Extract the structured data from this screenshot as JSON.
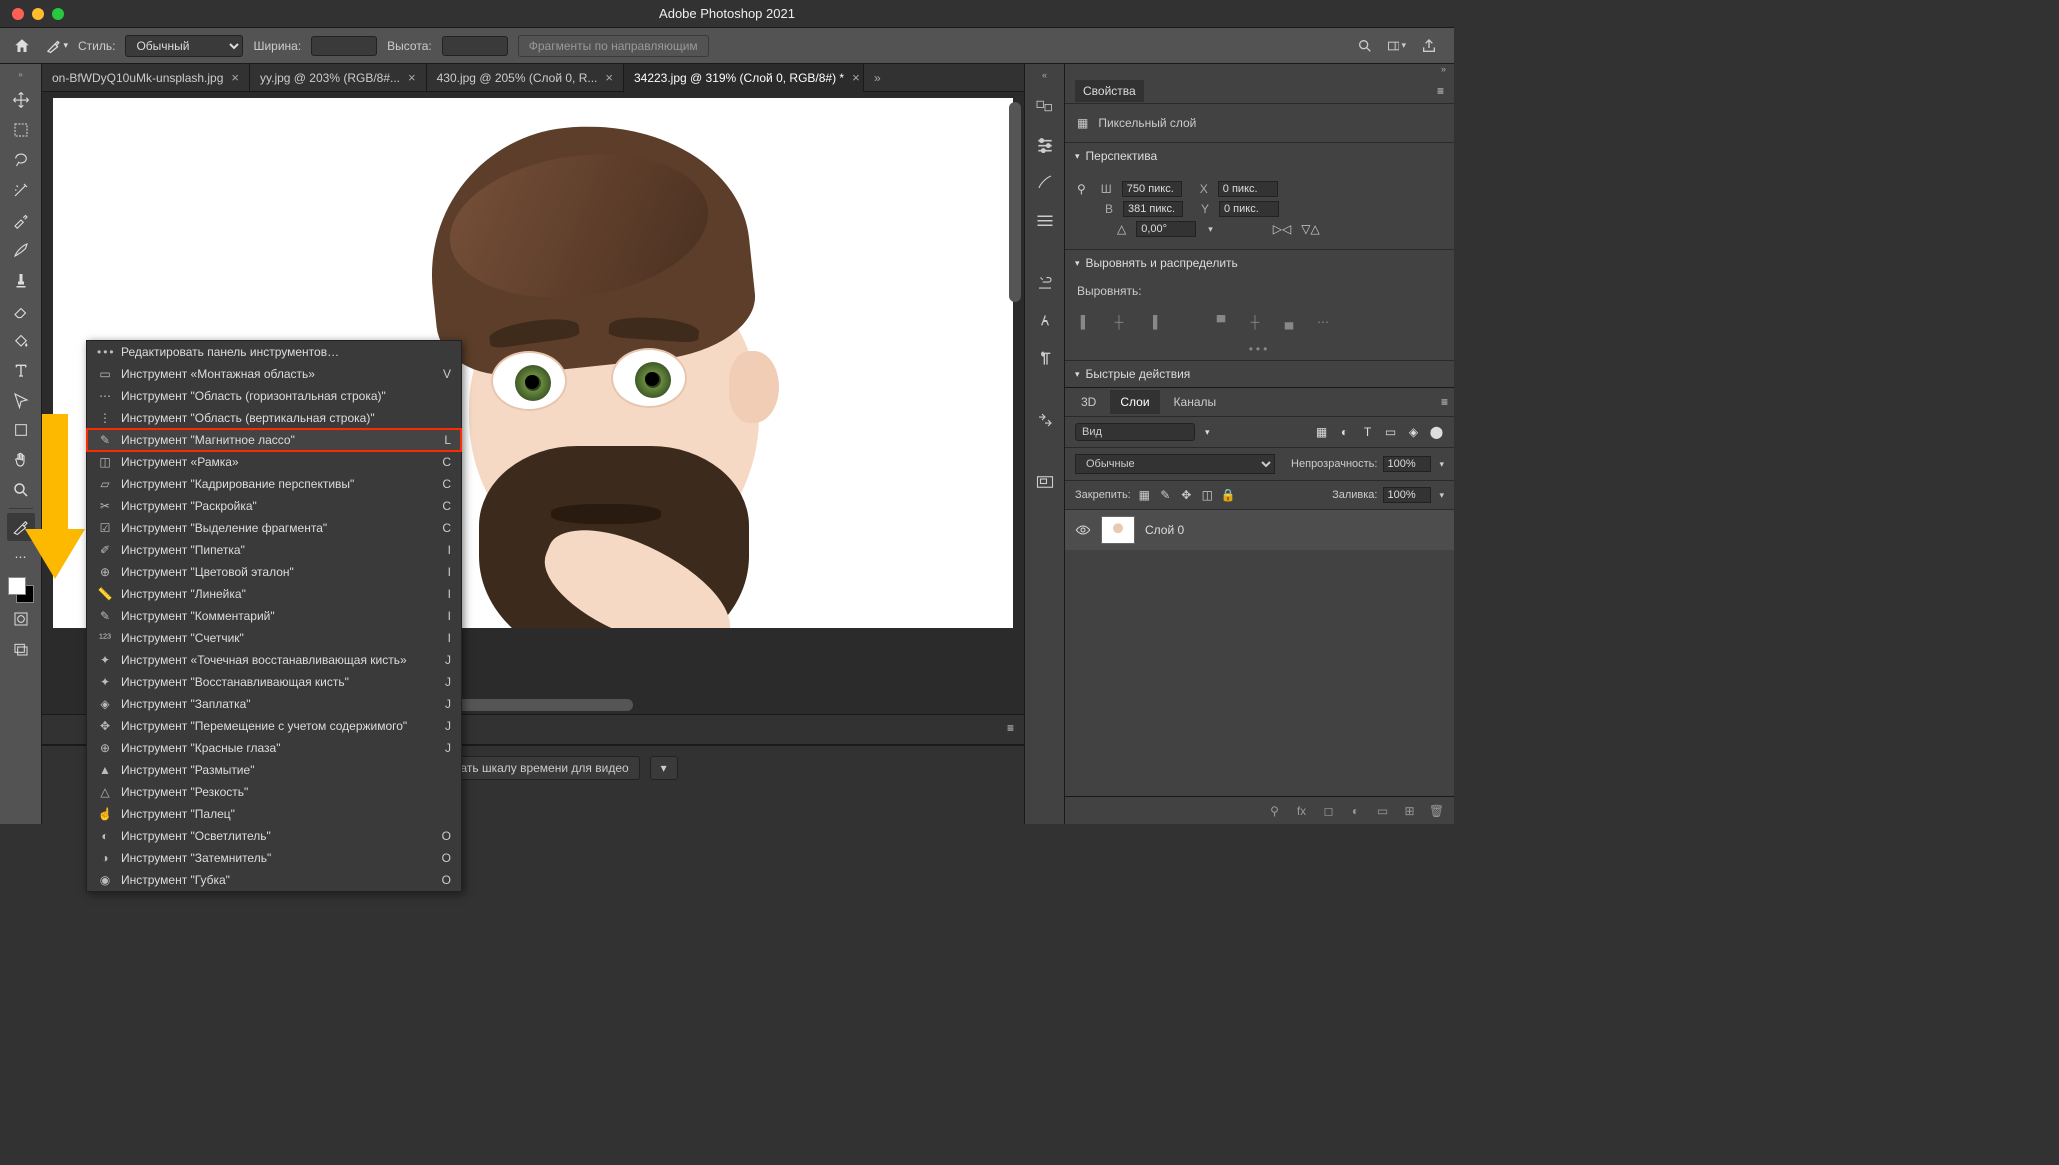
{
  "app_title": "Adobe Photoshop 2021",
  "optionsbar": {
    "style_label": "Стиль:",
    "style_value": "Обычный",
    "width_label": "Ширина:",
    "height_label": "Высота:",
    "guides_btn": "Фрагменты по направляющим"
  },
  "tabs": [
    {
      "label": "on-BfWDyQ10uMk-unsplash.jpg",
      "active": false
    },
    {
      "label": "yy.jpg @ 203% (RGB/8#...",
      "active": false
    },
    {
      "label": "430.jpg @ 205% (Слой 0, R...",
      "active": false
    },
    {
      "label": "34223.jpg @ 319% (Слой 0, RGB/8#) *",
      "active": true
    }
  ],
  "toolmenu": {
    "edit": "Редактировать панель инструментов…",
    "items": [
      {
        "label": "Инструмент «Монтажная область»",
        "key": "V",
        "ico": "▭"
      },
      {
        "label": "Инструмент \"Область (горизонтальная строка)\"",
        "key": "",
        "ico": "⋯"
      },
      {
        "label": "Инструмент \"Область (вертикальная строка)\"",
        "key": "",
        "ico": "⋮"
      },
      {
        "label": "Инструмент \"Магнитное лассо\"",
        "key": "L",
        "ico": "✎",
        "hl": true
      },
      {
        "label": "Инструмент «Рамка»",
        "key": "C",
        "ico": "◫"
      },
      {
        "label": "Инструмент \"Кадрирование перспективы\"",
        "key": "C",
        "ico": "▱"
      },
      {
        "label": "Инструмент \"Раскройка\"",
        "key": "C",
        "ico": "✂"
      },
      {
        "label": "Инструмент \"Выделение фрагмента\"",
        "key": "C",
        "ico": "☑"
      },
      {
        "label": "Инструмент \"Пипетка\"",
        "key": "I",
        "ico": "✐"
      },
      {
        "label": "Инструмент \"Цветовой эталон\"",
        "key": "I",
        "ico": "⊕"
      },
      {
        "label": "Инструмент \"Линейка\"",
        "key": "I",
        "ico": "📏"
      },
      {
        "label": "Инструмент \"Комментарий\"",
        "key": "I",
        "ico": "✎"
      },
      {
        "label": "Инструмент \"Счетчик\"",
        "key": "I",
        "ico": "¹²³"
      },
      {
        "label": "Инструмент «Точечная восстанавливающая кисть»",
        "key": "J",
        "ico": "✦"
      },
      {
        "label": "Инструмент \"Восстанавливающая кисть\"",
        "key": "J",
        "ico": "✦"
      },
      {
        "label": "Инструмент \"Заплатка\"",
        "key": "J",
        "ico": "◈"
      },
      {
        "label": "Инструмент \"Перемещение с учетом содержимого\"",
        "key": "J",
        "ico": "✥"
      },
      {
        "label": "Инструмент \"Красные глаза\"",
        "key": "J",
        "ico": "⊕"
      },
      {
        "label": "Инструмент \"Размытие\"",
        "key": "",
        "ico": "▲"
      },
      {
        "label": "Инструмент \"Резкость\"",
        "key": "",
        "ico": "△"
      },
      {
        "label": "Инструмент \"Палец\"",
        "key": "",
        "ico": "☝"
      },
      {
        "label": "Инструмент \"Осветлитель\"",
        "key": "O",
        "ico": "◐"
      },
      {
        "label": "Инструмент \"Затемнитель\"",
        "key": "O",
        "ico": "◑"
      },
      {
        "label": "Инструмент \"Губка\"",
        "key": "O",
        "ico": "◉"
      }
    ]
  },
  "timeline_btn": "Создать шкалу времени для видео",
  "properties": {
    "tab": "Свойства",
    "type": "Пиксельный слой",
    "sec_perspective": "Перспектива",
    "w_label": "Ш",
    "w": "750 пикс.",
    "h_label": "В",
    "h": "381 пикс.",
    "x_label": "X",
    "x": "0 пикс.",
    "y_label": "Y",
    "y": "0 пикс.",
    "angle": "0,00°",
    "sec_align": "Выровнять и распределить",
    "align_label": "Выровнять:",
    "sec_quick": "Быстрые действия"
  },
  "layers": {
    "tab_3d": "3D",
    "tab_layers": "Слои",
    "tab_channels": "Каналы",
    "search": "Вид",
    "blend": "Обычные",
    "opacity_label": "Непрозрачность:",
    "opacity": "100%",
    "lock_label": "Закрепить:",
    "fill_label": "Заливка:",
    "fill": "100%",
    "layer0": "Слой 0"
  }
}
